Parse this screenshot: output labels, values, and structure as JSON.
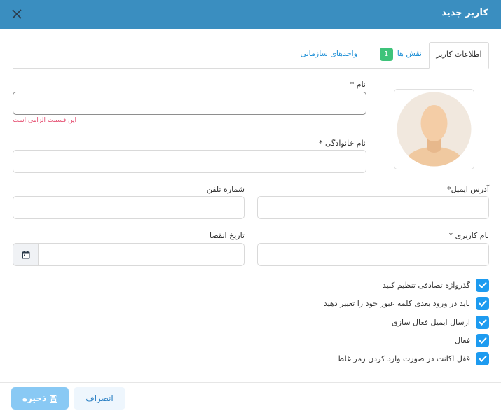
{
  "dialog": {
    "title": "کاربر جدید"
  },
  "tabs": {
    "user_info": "اطلاعات کاربر",
    "roles": "نقش ها",
    "roles_count": "1",
    "units": "واحدهای سازمانی"
  },
  "form": {
    "first_name_label": "نام *",
    "first_name_value": "",
    "first_name_error": "این قسمت الزامی است",
    "last_name_label": "نام خانوادگی *",
    "email_label": "آدرس ایمیل*",
    "phone_label": "شماره تلفن",
    "username_label": "نام کاربری *",
    "expiry_label": "تاریخ انقضا"
  },
  "options": [
    {
      "label": "گذرواژه تصادفی تنظیم کنید",
      "checked": true
    },
    {
      "label": "باید در ورود بعدی کلمه عبور خود را تغییر دهید",
      "checked": true
    },
    {
      "label": "ارسال ایمیل فعال سازی",
      "checked": true
    },
    {
      "label": "فعال",
      "checked": true
    },
    {
      "label": "قفل اکانت در صورت وارد کردن رمز غلط",
      "checked": true
    }
  ],
  "footer": {
    "save_label": "ذخیره",
    "cancel_label": "انصراف"
  },
  "icons": {
    "close": "close-icon",
    "calendar": "calendar-icon",
    "save": "floppy-disk-icon",
    "check": "check-icon",
    "avatar": "user-avatar-placeholder"
  },
  "colors": {
    "header": "#3a8ec0",
    "accent": "#1d9bf0",
    "error": "#e54b6e",
    "badge": "#3ec37a",
    "save_button": "#89c9f4"
  }
}
